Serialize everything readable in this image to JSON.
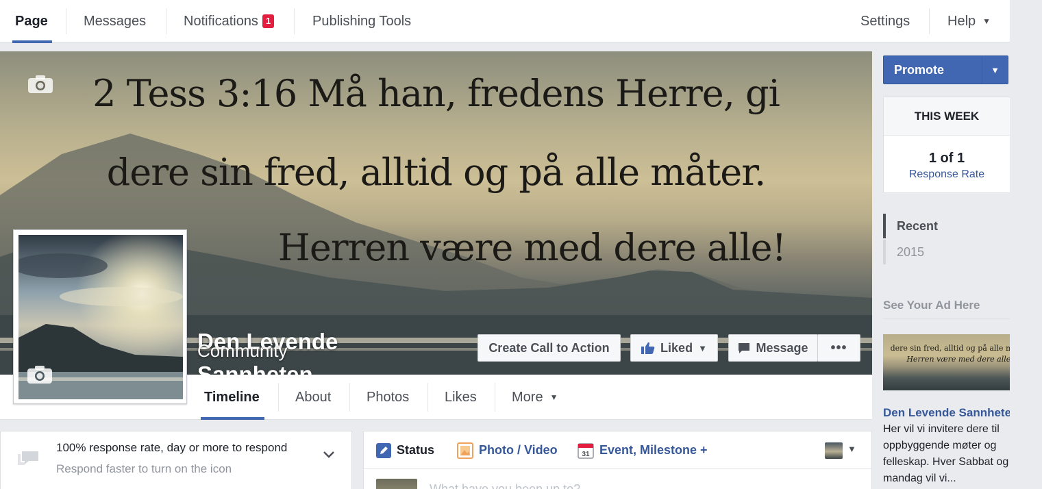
{
  "topnav": {
    "items": [
      "Page",
      "Messages",
      "Notifications",
      "Publishing Tools"
    ],
    "notifications_badge": "1",
    "right_items": [
      "Settings",
      "Help"
    ]
  },
  "cover": {
    "verse_lines": [
      "2 Tess 3:16 Må han, fredens Herre, gi",
      "dere sin fred, alltid og på alle måter.",
      "Herren være med dere alle!"
    ],
    "camera_icon": "camera-icon"
  },
  "page": {
    "name_line1": "Den Levende",
    "name_line2": "Sannheten",
    "category": "Community"
  },
  "actions": {
    "cta": "Create Call to Action",
    "liked": "Liked",
    "message": "Message",
    "more_dots": "•••"
  },
  "tabs": [
    "Timeline",
    "About",
    "Photos",
    "Likes",
    "More"
  ],
  "response_card": {
    "title": "100% response rate, day or more to respond",
    "subtitle": "Respond faster to turn on the icon"
  },
  "composer": {
    "tabs": [
      "Status",
      "Photo / Video",
      "Event, Milestone +"
    ],
    "placeholder": "What have you been up to?",
    "calendar_day": "31"
  },
  "sidebar": {
    "promote": "Promote",
    "this_week": "THIS WEEK",
    "response_count": "1 of 1",
    "response_label": "Response Rate",
    "years": [
      "Recent",
      "2015"
    ],
    "ad_header": "See Your Ad Here",
    "ad_lines": [
      "dere sin fred, alltid og på alle måter.",
      "Herren være med dere alle!"
    ],
    "ad_title": "Den Levende Sannheten",
    "ad_body": "Her vil vi invitere dere til oppbyggende møter og felleskap. Hver Sabbat og mandag vil vi..."
  },
  "colors": {
    "brand_blue": "#4267b2",
    "link_blue": "#365899",
    "badge_red": "#e41e3f"
  }
}
